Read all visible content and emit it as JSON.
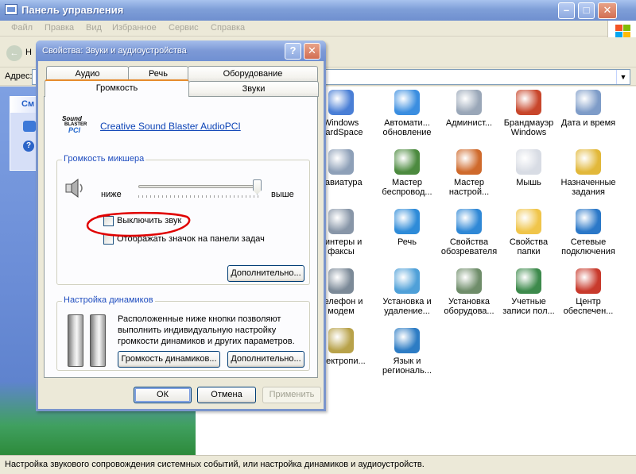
{
  "window": {
    "title": "Панель управления",
    "menu": [
      "Файл",
      "Правка",
      "Вид",
      "Избранное",
      "Сервис",
      "Справка"
    ],
    "back_stub": "Н",
    "address_label": "Адрес:",
    "leftpane_header": "См",
    "status": "Настройка звукового сопровождения системных событий, или настройка динамиков и аудиоустройств."
  },
  "control_panel_items": [
    {
      "label": "Windows CardSpace",
      "icon": "cardspace-icon"
    },
    {
      "label": "Автомати... обновление",
      "icon": "windows-update-icon"
    },
    {
      "label": "Админист...",
      "icon": "admin-tools-icon"
    },
    {
      "label": "Брандмауэр Windows",
      "icon": "firewall-icon"
    },
    {
      "label": "Дата и время",
      "icon": "datetime-icon"
    },
    {
      "label": "лавиатура",
      "icon": "keyboard-icon"
    },
    {
      "label": "Мастер беспровод...",
      "icon": "wireless-wizard-icon"
    },
    {
      "label": "Мастер настрой...",
      "icon": "network-wizard-icon"
    },
    {
      "label": "Мышь",
      "icon": "mouse-icon"
    },
    {
      "label": "Назначенные задания",
      "icon": "scheduled-tasks-icon"
    },
    {
      "label": "ринтеры и факсы",
      "icon": "printers-icon"
    },
    {
      "label": "Речь",
      "icon": "speech-icon"
    },
    {
      "label": "Свойства обозревателя",
      "icon": "internet-options-icon"
    },
    {
      "label": "Свойства папки",
      "icon": "folder-options-icon"
    },
    {
      "label": "Сетевые подключения",
      "icon": "network-connections-icon"
    },
    {
      "label": "Телефон и модем",
      "icon": "phone-modem-icon"
    },
    {
      "label": "Установка и удаление...",
      "icon": "add-remove-icon"
    },
    {
      "label": "Установка оборудова...",
      "icon": "add-hardware-icon"
    },
    {
      "label": "Учетные записи пол...",
      "icon": "user-accounts-icon"
    },
    {
      "label": "Центр обеспечен...",
      "icon": "security-center-icon"
    },
    {
      "label": "электропи...",
      "icon": "power-options-icon"
    },
    {
      "label": "Язык и региональ...",
      "icon": "regional-options-icon"
    }
  ],
  "dialog": {
    "title": "Свойства: Звуки и аудиоустройства",
    "tabs_back": [
      "Аудио",
      "Речь",
      "Оборудование"
    ],
    "tabs_front": [
      "Громкость",
      "Звуки"
    ],
    "active_tab": "Громкость",
    "device_name": "Creative Sound Blaster AudioPCI",
    "logo": {
      "l1": "Sound",
      "l2": "BLASTER",
      "l3": "PCI"
    },
    "mixer": {
      "title": "Громкость микшера",
      "low": "ниже",
      "high": "выше",
      "level": 100,
      "mute_label": "Выключить звук",
      "mute_checked": false,
      "tray_label": "Отображать значок на панели задач",
      "tray_checked": false,
      "advanced_button": "Дополнительно..."
    },
    "speakers": {
      "title": "Настройка динамиков",
      "description": "Расположенные ниже кнопки позволяют выполнить индивидуальную настройку громкости динамиков и других параметров.",
      "volume_button": "Громкость динамиков...",
      "advanced_button": "Дополнительно..."
    },
    "ok": "ОК",
    "cancel": "Отмена",
    "apply": "Применить"
  },
  "colors": {
    "title_gradient_top": "#a8c2ee",
    "title_gradient_bottom": "#6f8fcf",
    "link": "#0c43b6",
    "group_title": "#1f4dbf",
    "annotation_red": "#e00000"
  }
}
